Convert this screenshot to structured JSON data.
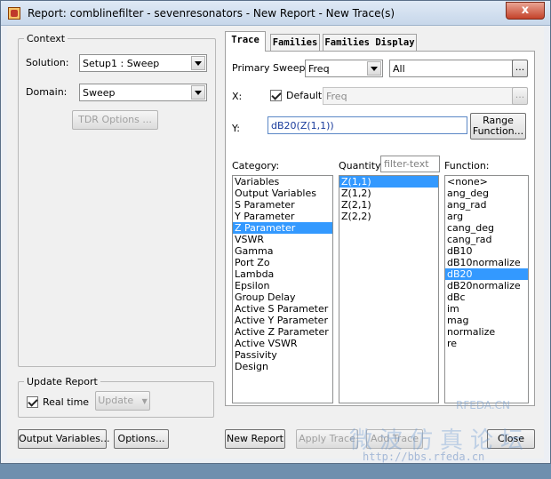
{
  "window": {
    "title": "Report: comblinefilter - sevenresonators - New Report - New Trace(s)",
    "close_glyph": "x"
  },
  "context": {
    "label": "Context",
    "solution_label": "Solution:",
    "solution_value": "Setup1 : Sweep",
    "domain_label": "Domain:",
    "domain_value": "Sweep",
    "tdr_button": "TDR Options ..."
  },
  "update_report": {
    "label": "Update Report",
    "realtime_label": "Real time",
    "realtime_checked": true,
    "update_button": "Update"
  },
  "bottom_left": {
    "output_variables_button": "Output Variables...",
    "options_button": "Options..."
  },
  "tabs": [
    {
      "label": "Trace",
      "active": true
    },
    {
      "label": "Families",
      "active": false
    },
    {
      "label": "Families Display",
      "active": false
    }
  ],
  "trace": {
    "primary_sweep_label": "Primary Sweep:",
    "primary_sweep_value": "Freq",
    "primary_sweep_range": "All",
    "browse_button": "...",
    "x_label": "X:",
    "default_label": "Default",
    "default_checked": true,
    "x_value": "Freq",
    "x_browse_button": "...",
    "y_label": "Y:",
    "y_value": "dB20(Z(1,1))",
    "range_function_button_line1": "Range",
    "range_function_button_line2": "Function..."
  },
  "category": {
    "label": "Category:",
    "items": [
      "Variables",
      "Output Variables",
      "S Parameter",
      "Y Parameter",
      "Z Parameter",
      "VSWR",
      "Gamma",
      "Port Zo",
      "Lambda",
      "Epsilon",
      "Group Delay",
      "Active S Parameter",
      "Active Y Parameter",
      "Active Z Parameter",
      "Active VSWR",
      "Passivity",
      "Design"
    ],
    "selected": 4
  },
  "quantity": {
    "label": "Quantity:",
    "filter_placeholder": "filter-text",
    "items": [
      "Z(1,1)",
      "Z(1,2)",
      "Z(2,1)",
      "Z(2,2)"
    ],
    "selected": 0
  },
  "function": {
    "label": "Function:",
    "items": [
      "<none>",
      "ang_deg",
      "ang_rad",
      "arg",
      "cang_deg",
      "cang_rad",
      "dB10",
      "dB10normalize",
      "dB20",
      "dB20normalize",
      "dBc",
      "im",
      "mag",
      "normalize",
      "re"
    ],
    "selected": 8
  },
  "bottom_right": {
    "new_report_button": "New Report",
    "apply_trace_button": "Apply Trace",
    "add_trace_button": "Add Trace",
    "close_button": "Close"
  },
  "watermark": {
    "line1": "RFEDA.CN",
    "line2": "http://bbs.rfeda.cn",
    "chinese": "微波仿真论坛"
  }
}
